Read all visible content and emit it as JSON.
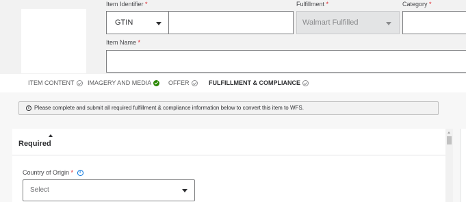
{
  "header": {
    "item_identifier_label": "Item Identifier",
    "fulfillment_label": "Fulfillment",
    "category_label": "Category",
    "item_name_label": "Item Name",
    "required_marker": "*",
    "identifier_type": "GTIN",
    "identifier_value": "",
    "fulfillment_value": "Walmart Fulfilled",
    "category_value": "",
    "item_name_value": ""
  },
  "tabs": [
    {
      "label": "ITEM CONTENT",
      "status": "incomplete"
    },
    {
      "label": "IMAGERY AND MEDIA",
      "status": "complete"
    },
    {
      "label": "OFFER",
      "status": "incomplete"
    },
    {
      "label": "FULFILLMENT & COMPLIANCE",
      "status": "incomplete",
      "active": true
    }
  ],
  "alert": {
    "icon": "info-icon",
    "icon_glyph": "i",
    "text": "Please complete and submit all required fulfillment & compliance information below to convert this item to WFS."
  },
  "section": {
    "title": "Required",
    "country_label": "Country of Origin",
    "country_info_glyph": "i",
    "country_placeholder": "Select"
  },
  "colors": {
    "required": "#de1c24",
    "complete": "#2a8703",
    "info": "#0071dc"
  }
}
